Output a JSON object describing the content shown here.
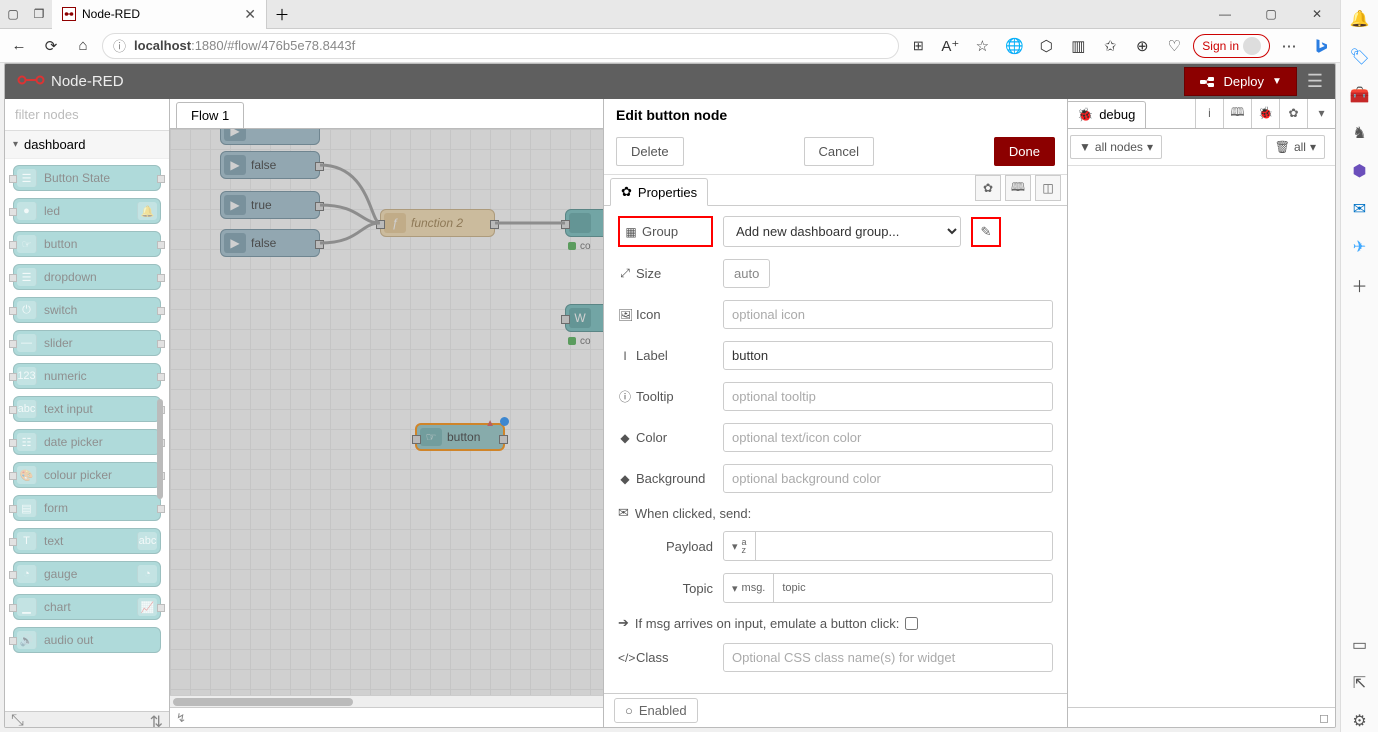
{
  "browser": {
    "tab_title": "Node-RED",
    "url_host": "localhost",
    "url_path": ":1880/#flow/476b5e78.8443f",
    "sign_in": "Sign in"
  },
  "header": {
    "brand": "Node-RED",
    "deploy": "Deploy"
  },
  "palette": {
    "filter_placeholder": "filter nodes",
    "category": "dashboard",
    "nodes": [
      "Button State",
      "led",
      "button",
      "dropdown",
      "switch",
      "slider",
      "numeric",
      "text input",
      "date picker",
      "colour picker",
      "form",
      "text",
      "gauge",
      "chart",
      "audio out"
    ]
  },
  "flow": {
    "tab": "Flow 1",
    "nodes": {
      "false1": "false",
      "true": "true",
      "false2": "false",
      "function": "function 2",
      "button": "button",
      "status": "co"
    }
  },
  "edit": {
    "title": "Edit button node",
    "delete": "Delete",
    "cancel": "Cancel",
    "done": "Done",
    "properties": "Properties",
    "labels": {
      "group": "Group",
      "size": "Size",
      "icon": "Icon",
      "label": "Label",
      "tooltip": "Tooltip",
      "color": "Color",
      "background": "Background",
      "payload": "Payload",
      "topic": "Topic",
      "class": "Class"
    },
    "group_select": "Add new dashboard group...",
    "size_auto": "auto",
    "icon_placeholder": "optional icon",
    "label_value": "button",
    "tooltip_placeholder": "optional tooltip",
    "color_placeholder": "optional text/icon color",
    "background_placeholder": "optional background color",
    "when_clicked": "When clicked, send:",
    "payload_type": "a z",
    "topic_prefix": "msg.",
    "topic_value": "topic",
    "emulate": "If msg arrives on input, emulate a button click:",
    "class_placeholder": "Optional CSS class name(s) for widget",
    "enabled": "Enabled"
  },
  "sidebar": {
    "tab": "debug",
    "filter": "all nodes",
    "clear": "all"
  }
}
